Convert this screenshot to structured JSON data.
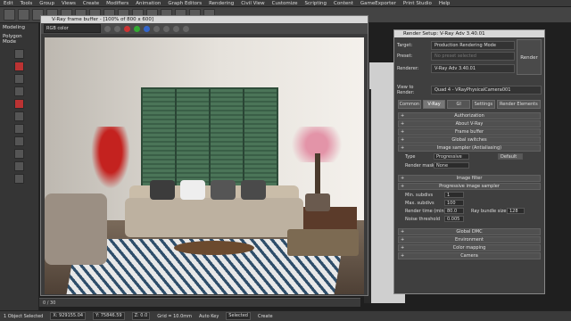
{
  "menubar": [
    "Edit",
    "Tools",
    "Group",
    "Views",
    "Create",
    "Modifiers",
    "Animation",
    "Graph Editors",
    "Rendering",
    "Civil View",
    "Customize",
    "Scripting",
    "Content",
    "GameExporter",
    "Print Studio",
    "Help"
  ],
  "ribbon": {
    "tab": "Modeling",
    "sub": "Polygon Mode"
  },
  "vfb": {
    "title": "V-Ray frame buffer - [100% of 800 x 600]",
    "channel": "RGB color"
  },
  "render_setup": {
    "title": "Render Setup: V-Ray Adv 3.40.01",
    "target_label": "Target:",
    "target_value": "Production Rendering Mode",
    "preset_label": "Preset:",
    "preset_value": "No preset selected",
    "renderer_label": "Renderer:",
    "renderer_value": "V-Ray Adv 3.40.01",
    "view_label": "View to Render:",
    "view_value": "Quad 4 - VRayPhysicalCamera001",
    "render_button": "Render",
    "tabs": [
      "Common",
      "V-Ray",
      "GI",
      "Settings",
      "Render Elements"
    ],
    "rollouts_top": [
      "Authorization",
      "About V-Ray",
      "Frame buffer",
      "Global switches"
    ],
    "image_sampler_header": "Image sampler (Antialiasing)",
    "type_label": "Type",
    "type_value": "Progressive",
    "render_mask_label": "Render mask",
    "render_mask_value": "None",
    "default_button": "Default",
    "image_filter": "Image filter",
    "progressive_header": "Progressive image sampler",
    "min_subdivs_label": "Min. subdivs",
    "min_subdivs_value": "1",
    "max_subdivs_label": "Max. subdivs",
    "max_subdivs_value": "100",
    "render_time_label": "Render time (min)",
    "render_time_value": "80.0",
    "ray_bundle_label": "Ray bundle size",
    "ray_bundle_value": "128",
    "noise_label": "Noise threshold",
    "noise_value": "0.005",
    "rollouts_bottom": [
      "Global DMC",
      "Environment",
      "Color mapping",
      "Camera"
    ]
  },
  "timeline": "0 / 30",
  "status": {
    "selection": "1 Object Selected",
    "x": "X: 929155.04",
    "y": "Y: 75846.59",
    "z": "Z: 0.0",
    "grid": "Grid = 10.0mm",
    "autokey": "Auto Key",
    "selected": "Selected",
    "create": "Create"
  }
}
